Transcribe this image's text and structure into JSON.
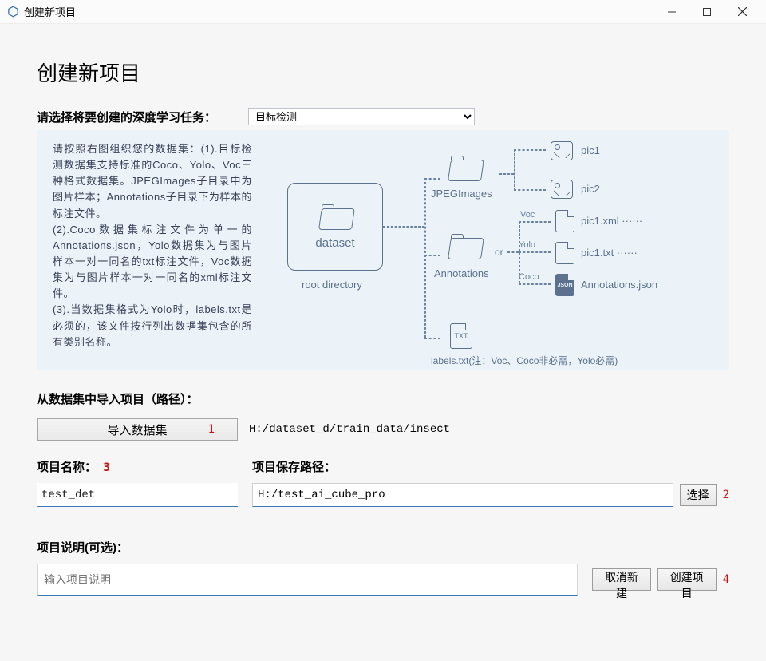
{
  "window": {
    "title": "创建新项目"
  },
  "page": {
    "heading": "创建新项目"
  },
  "task": {
    "label": "请选择将要创建的深度学习任务：",
    "selected": "目标检测"
  },
  "info": {
    "lines": "请按照右图组织您的数据集：(1).目标检测数据集支持标准的Coco、Yolo、Voc三种格式数据集。JPEGImages子目录中为图片样本；Annotations子目录下为样本的标注文件。\n(2).Coco数据集标注文件为单一的Annotations.json，Yolo数据集为与图片样本一对一同名的txt标注文件，Voc数据集为与图片样本一对一同名的xml标注文件。\n(3).当数据集格式为Yolo时，labels.txt是必须的，该文件按行列出数据集包含的所有类别名称。"
  },
  "diagram": {
    "root": "dataset",
    "root_sub": "root directory",
    "jpeg_dir": "JPEGImages",
    "ann_dir": "Annotations",
    "or": "or",
    "formats": {
      "voc": "Voc",
      "yolo": "Yolo",
      "coco": "Coco"
    },
    "pic1": "pic1",
    "pic2": "pic2",
    "pic1xml": "pic1.xml ······",
    "pic1txt": "pic1.txt ······",
    "annjson": "Annotations.json",
    "jsonbadge": "JSON",
    "labels_file": "TXT",
    "labels_note": "labels.txt(注：Voc、Coco非必需，Yolo必需)"
  },
  "import": {
    "section_label": "从数据集中导入项目（路径）：",
    "button": "导入数据集",
    "marker": "1",
    "path": "H:/dataset_d/train_data/insect"
  },
  "project_name": {
    "label": "项目名称：",
    "marker": "3",
    "value": "test_det"
  },
  "save_path": {
    "label": "项目保存路径：",
    "value": "H:/test_ai_cube_pro",
    "browse": "选择",
    "marker": "2"
  },
  "description": {
    "label": "项目说明(可选)：",
    "placeholder": "输入项目说明"
  },
  "actions": {
    "cancel": "取消新建",
    "create": "创建项目",
    "marker": "4"
  }
}
